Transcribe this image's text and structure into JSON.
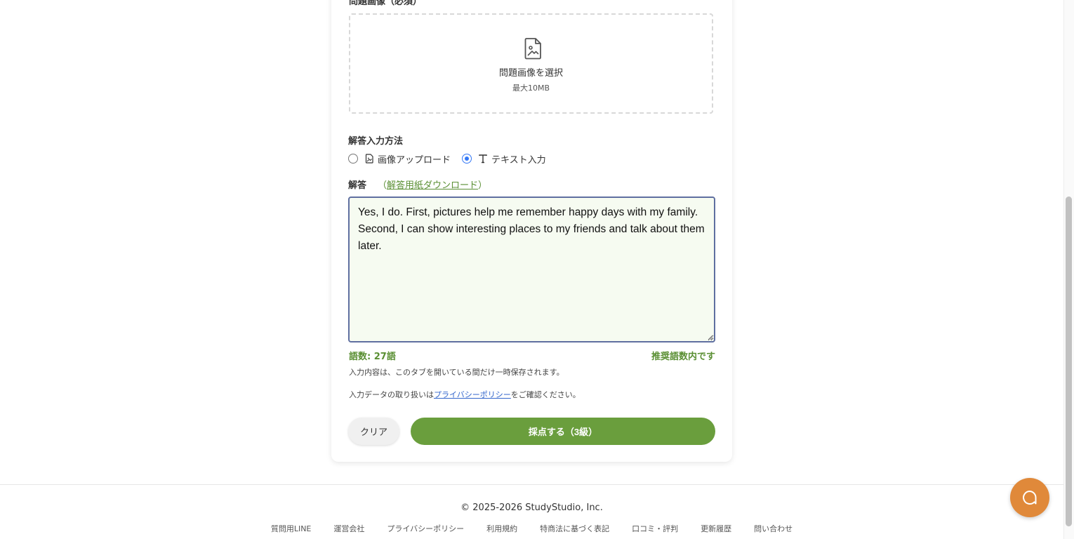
{
  "form": {
    "problem_image_label": "問題画像（必須）",
    "upload": {
      "title": "問題画像を選択",
      "limit": "最大10MB",
      "icon": "image-file-icon"
    },
    "answer_method_label": "解答入力方法",
    "answer_methods": [
      {
        "label": "画像アップロード",
        "icon": "image-file-icon",
        "selected": false
      },
      {
        "label": "テキスト入力",
        "icon": "text-icon",
        "selected": true
      }
    ],
    "answer_label": "解答",
    "answer_sheet_open": "（",
    "answer_sheet_link": "解答用紙ダウンロード",
    "answer_sheet_close": "）",
    "answer_text": "Yes, I do. First, pictures help me remember happy days with my family. Second, I can show interesting places to my friends and talk about them later.",
    "word_count": "語数: 27語",
    "word_status": "推奨語数内です",
    "note_save": "入力内容は、このタブを開いている間だけ一時保存されます。",
    "note_privacy_prefix": "入力データの取り扱いは",
    "note_privacy_link": "プライバシーポリシー",
    "note_privacy_suffix": "をご確認ください。",
    "clear_button": "クリア",
    "submit_button": "採点する（3級）"
  },
  "footer": {
    "copyright": "© 2025-2026 StudyStudio, Inc.",
    "links": [
      "質問用LINE",
      "運営会社",
      "プライバシーポリシー",
      "利用規約",
      "特商法に基づく表記",
      "口コミ・評判",
      "更新履歴",
      "問い合わせ"
    ]
  },
  "colors": {
    "accent_green": "#6a9e3d",
    "text_green": "#5a8f33",
    "chat_orange": "#e0893a",
    "link_blue": "#3366cc"
  },
  "chat_widget": {
    "icon": "chat-bubble-icon"
  }
}
